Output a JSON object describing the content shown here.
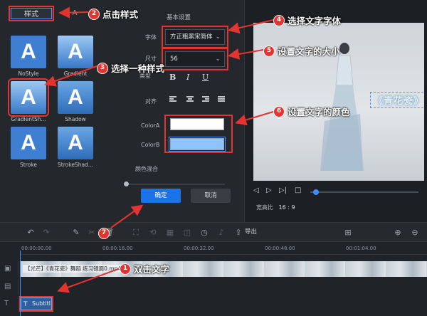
{
  "style_panel": {
    "tabs": [
      {
        "label": "样式",
        "active": true
      },
      {
        "label": "A",
        "active": false
      }
    ],
    "styles": [
      {
        "glyph": "A",
        "name": "NoStyle"
      },
      {
        "glyph": "A",
        "name": "Gradient"
      },
      {
        "glyph": "A",
        "name": "GradientSh...",
        "selected": true
      },
      {
        "glyph": "A",
        "name": "Shadow"
      },
      {
        "glyph": "A",
        "name": "Stroke"
      },
      {
        "glyph": "A",
        "name": "StrokeShad..."
      }
    ]
  },
  "settings": {
    "section_title": "基本设置",
    "font_label": "字体",
    "font_value": "方正粗黑宋简体",
    "size_label": "尺寸",
    "size_value": "56",
    "type_label": "类型",
    "format_buttons": {
      "bold": "B",
      "italic": "I",
      "underline": "U"
    },
    "align_label": "对齐",
    "color_a_label": "ColorA",
    "color_a": "#ffffff",
    "color_b_label": "ColorB",
    "color_b": "#8cc4fb",
    "blend_label": "颜色混合",
    "confirm_label": "确定",
    "cancel_label": "取消"
  },
  "preview": {
    "caption": "《青花瓷》",
    "aspect_label": "宽高比",
    "aspect_value": "16 : 9"
  },
  "toolbar": {
    "export_label": "导出"
  },
  "timeline": {
    "ticks": [
      "00:00:00.00",
      "00:00:16.00",
      "00:00:32.00",
      "00:00:48.00",
      "00:01:04.00"
    ],
    "video_clip_label": "【光芒】《青花瓷》舞蹈 练习镜面0.mp4",
    "text_clip_label": "Subtitl"
  },
  "annotations": {
    "a1": {
      "num": "1",
      "text": "双击文字"
    },
    "a2": {
      "num": "2",
      "text": "点击样式"
    },
    "a3": {
      "num": "3",
      "text": "选择一种样式"
    },
    "a4": {
      "num": "4",
      "text": "选择文字字体"
    },
    "a5": {
      "num": "5",
      "text": "设置文字的大小"
    },
    "a6": {
      "num": "6",
      "text": "设置文字的颜色"
    },
    "a7": {
      "num": "7",
      "text": ""
    }
  },
  "colors": {
    "accent": "#1b73e8",
    "highlight": "#e3342f"
  }
}
